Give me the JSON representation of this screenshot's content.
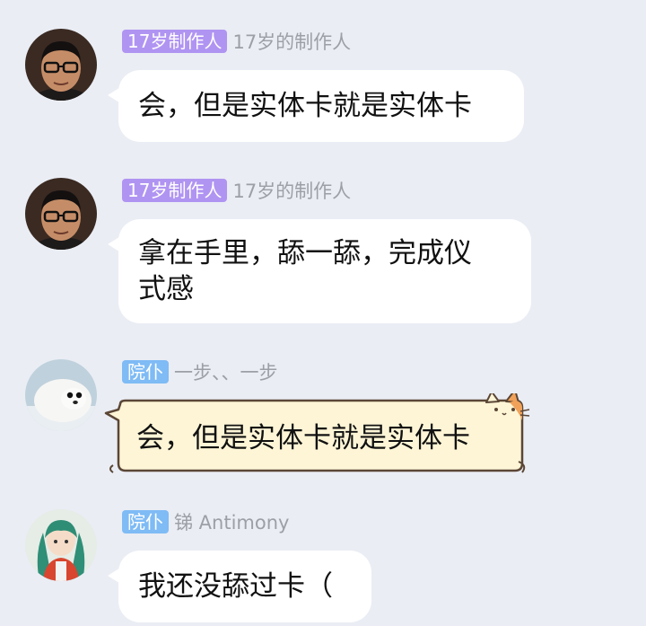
{
  "messages": [
    {
      "tag": "17岁制作人",
      "nickname": "17岁的制作人",
      "text": "会，但是实体卡就是实体卡",
      "avatar": "avatar-man-glasses"
    },
    {
      "tag": "17岁制作人",
      "nickname": "17岁的制作人",
      "text_line1": "拿在手里，舔一舔，完成仪",
      "text_line2": "式感",
      "avatar": "avatar-man-glasses"
    },
    {
      "tag": "院仆",
      "nickname": "一步、、一步",
      "text": "会，但是实体卡就是实体卡",
      "avatar": "avatar-seal",
      "bubble_style": "cat-bubble"
    },
    {
      "tag": "院仆",
      "nickname": "锑 Antimony",
      "text": "我还没舔过卡（",
      "avatar": "avatar-anime-girl"
    }
  ],
  "colors": {
    "background": "#eaedf4",
    "tag_purple": "#b094f2",
    "tag_blue": "#7fbbf5",
    "nickname": "#9d9fa6",
    "bubble": "#ffffff",
    "cat_bubble_fill": "#fdf5d6",
    "cat_bubble_outline": "#5b4636"
  }
}
